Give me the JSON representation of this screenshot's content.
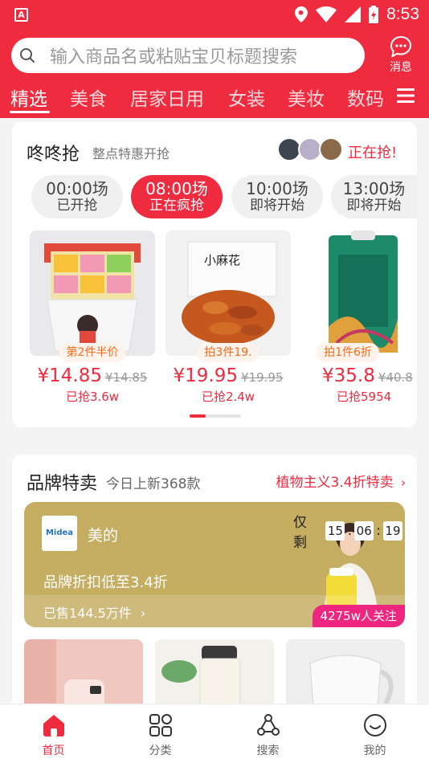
{
  "status_bar": {
    "time": "8:53",
    "app_icon_letter": "A"
  },
  "search": {
    "placeholder": "输入商品名或粘贴宝贝标题搜索"
  },
  "message": {
    "label": "消息"
  },
  "categories": [
    {
      "label": "精选"
    },
    {
      "label": "美食"
    },
    {
      "label": "居家日用"
    },
    {
      "label": "女装"
    },
    {
      "label": "美妆"
    },
    {
      "label": "数码"
    }
  ],
  "flash_sale": {
    "title": "咚咚抢",
    "subtitle": "整点特惠开抢",
    "live_label": "正在抢!",
    "slots": [
      {
        "time": "00:00场",
        "status": "已开抢"
      },
      {
        "time": "08:00场",
        "status": "正在疯抢"
      },
      {
        "time": "10:00场",
        "status": "即将开始"
      },
      {
        "time": "13:00场",
        "status": "即将开始"
      }
    ],
    "products": [
      {
        "tag": "第2件半价",
        "price": "¥14.85",
        "old_price": "¥14.85",
        "sold": "已抢3.6w"
      },
      {
        "tag": "拍3件19.",
        "price": "¥19.95",
        "old_price": "¥19.95",
        "sold": "已抢2.4w"
      },
      {
        "tag": "拍1件6折",
        "price": "¥35.8",
        "old_price": "¥40.8",
        "sold": "已抢5954"
      }
    ]
  },
  "brand_sale": {
    "title": "品牌特卖",
    "subtitle": "今日上新368款",
    "promo": "植物主义3.4折特卖",
    "banner": {
      "logo_text": "Midea",
      "brand": "美的",
      "countdown_label": "仅剩",
      "hours": "15",
      "minutes": "06",
      "seconds": "19",
      "discount": "品牌折扣低至3.4折",
      "sold": "已售144.5万件",
      "followers": "4275w人关注"
    }
  },
  "tabbar": [
    {
      "label": "首页"
    },
    {
      "label": "分类"
    },
    {
      "label": "搜索"
    },
    {
      "label": "我的"
    }
  ],
  "colors": {
    "brand_red": "#ee2b3f",
    "banner_gold": "#c5ad61",
    "follow_pink": "#ee2680"
  }
}
